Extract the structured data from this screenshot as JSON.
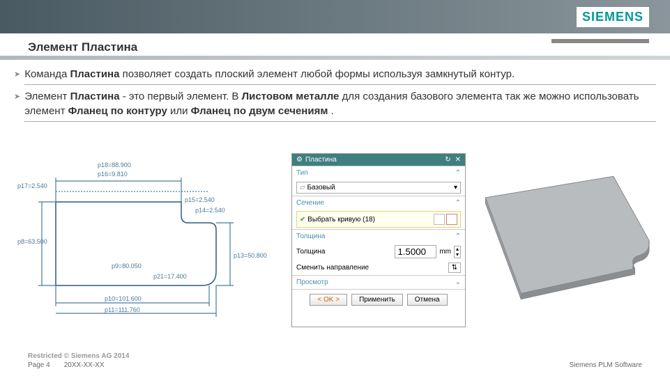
{
  "brand": "SIEMENS",
  "title": "Элемент  Пластина",
  "bullets": [
    {
      "pre": "Команда ",
      "b1": "Пластина",
      "mid": " позволяет создать плоский элемент любой формы используя замкнутый контур.",
      "b2": "",
      "tail": ""
    },
    {
      "pre": "Элемент ",
      "b1": "Пластина",
      "mid": " - это первый элемент. В ",
      "b2": "Листовом металле",
      "tail": " для создания  базового элемента так же можно  использовать элемент ",
      "b3": "Фланец по контуру",
      "tail2": " или ",
      "b4": "Фланец по двум сечениям",
      "tail3": " ."
    }
  ],
  "sketch": {
    "dims": {
      "p18": "p18=88.900",
      "p16": "p16=9.810",
      "p17": "p17=2.540",
      "p15": "p15=2.540",
      "p14": "p14=2.540",
      "p8": "p8=63.500",
      "p13": "p13=50.800",
      "p9": "p9=80.050",
      "p21": "p21=17.400",
      "p10": "p10=101.600",
      "p11": "p11=111.760"
    }
  },
  "dialog": {
    "title": "Пластина",
    "sections": {
      "type": "Тип",
      "section": "Сечение",
      "thickness": "Толщина",
      "preview": "Просмотр"
    },
    "type_value": "Базовый",
    "select_curve": "Выбрать кривую (18)",
    "thickness_label": "Толщина",
    "thickness_value": "1.5000",
    "unit": "mm",
    "flip_label": "Сменить направление",
    "buttons": {
      "ok": "< OK >",
      "apply": "Применить",
      "cancel": "Отмена"
    }
  },
  "footer": {
    "restricted": "Restricted © Siemens AG 2014",
    "page": "Page 4",
    "date": "20XX-XX-XX",
    "right": "Siemens PLM Software"
  }
}
